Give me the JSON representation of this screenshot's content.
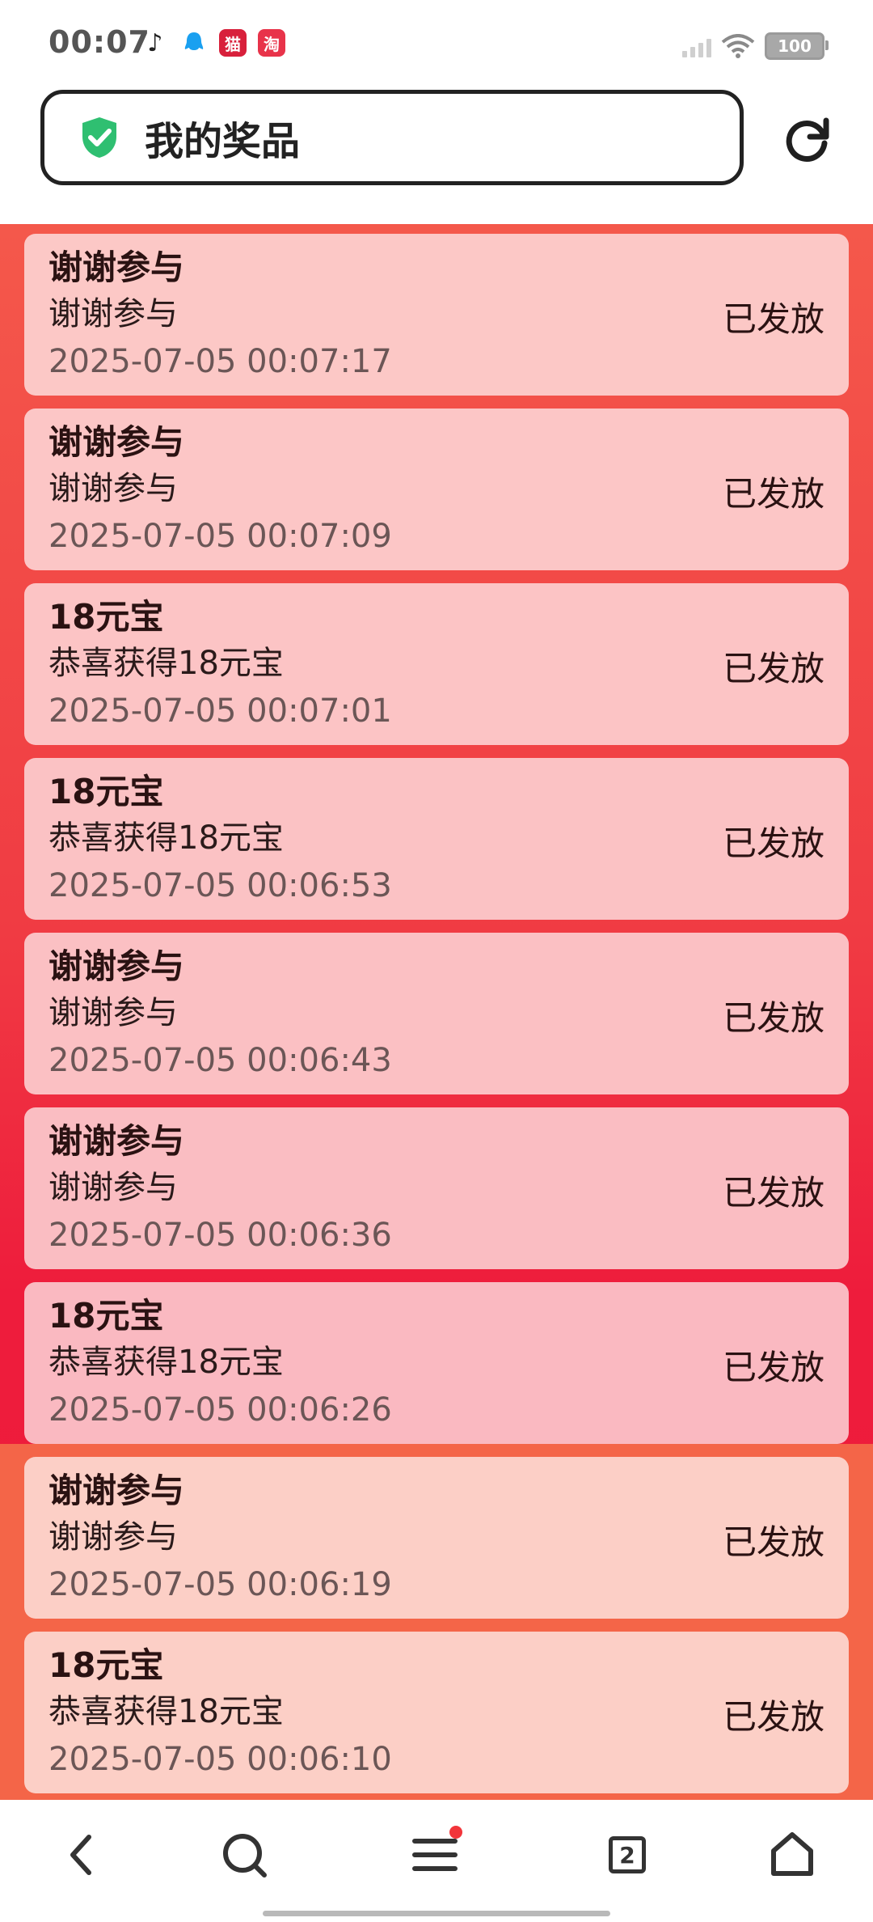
{
  "status_bar": {
    "time": "00:07",
    "battery": "100",
    "apps": [
      {
        "name": "tiktok",
        "glyph": "♪"
      },
      {
        "name": "qq",
        "glyph": "🔔"
      },
      {
        "name": "tmall",
        "glyph": "猫"
      },
      {
        "name": "taobao",
        "glyph": "淘"
      }
    ]
  },
  "header": {
    "title": "我的奖品"
  },
  "prizes": [
    {
      "title": "谢谢参与",
      "desc": "谢谢参与",
      "time": "2025-07-05 00:07:17",
      "status": "已发放"
    },
    {
      "title": "谢谢参与",
      "desc": "谢谢参与",
      "time": "2025-07-05 00:07:09",
      "status": "已发放"
    },
    {
      "title": "18元宝",
      "desc": "恭喜获得18元宝",
      "time": "2025-07-05 00:07:01",
      "status": "已发放"
    },
    {
      "title": "18元宝",
      "desc": "恭喜获得18元宝",
      "time": "2025-07-05 00:06:53",
      "status": "已发放"
    },
    {
      "title": "谢谢参与",
      "desc": "谢谢参与",
      "time": "2025-07-05 00:06:43",
      "status": "已发放"
    },
    {
      "title": "谢谢参与",
      "desc": "谢谢参与",
      "time": "2025-07-05 00:06:36",
      "status": "已发放"
    },
    {
      "title": "18元宝",
      "desc": "恭喜获得18元宝",
      "time": "2025-07-05 00:06:26",
      "status": "已发放"
    },
    {
      "title": "谢谢参与",
      "desc": "谢谢参与",
      "time": "2025-07-05 00:06:19",
      "status": "已发放"
    },
    {
      "title": "18元宝",
      "desc": "恭喜获得18元宝",
      "time": "2025-07-05 00:06:10",
      "status": "已发放"
    }
  ],
  "bottom_nav": {
    "tab_count": "2"
  },
  "colors": {
    "card_upper": "#fbc3c3",
    "card_lower": "#fbcfc6",
    "shield": "#2fbf71"
  }
}
